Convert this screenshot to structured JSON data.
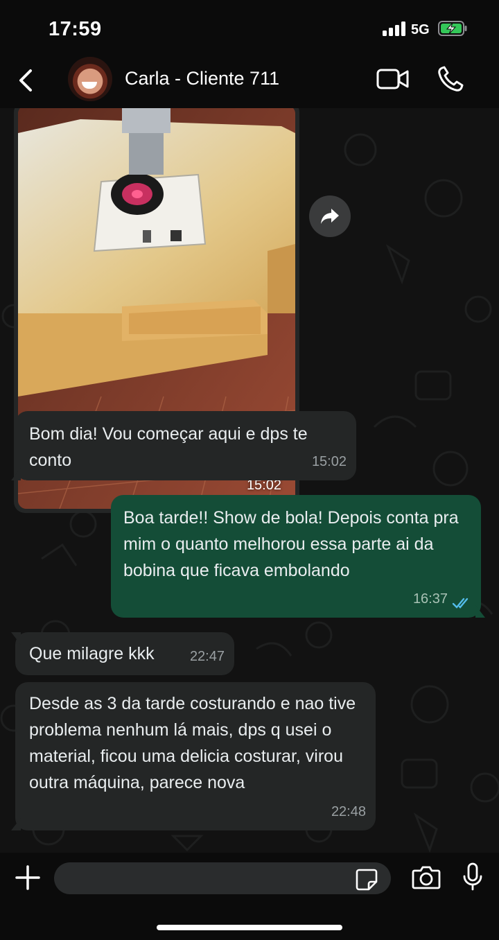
{
  "status_bar": {
    "time": "17:59",
    "network": "5G"
  },
  "header": {
    "contact_name": "Carla - Cliente 711"
  },
  "messages": [
    {
      "type": "image",
      "direction": "incoming",
      "time": "15:02"
    },
    {
      "type": "text",
      "direction": "incoming",
      "text": "Bom dia! Vou começar aqui e dps te conto",
      "time": "15:02"
    },
    {
      "type": "text",
      "direction": "outgoing",
      "text": "Boa tarde!! Show de bola! Depois conta pra mim o quanto melhorou essa parte ai da bobina que ficava embolando",
      "time": "16:37",
      "status": "read"
    },
    {
      "type": "text",
      "direction": "incoming",
      "text": "Que milagre kkk",
      "time": "22:47"
    },
    {
      "type": "text",
      "direction": "incoming",
      "text": "Desde as 3 da tarde costurando e nao tive problema nenhum lá mais, dps q usei o material, ficou uma delicia costurar, virou outra máquina, parece nova",
      "time": "22:48"
    }
  ],
  "composer": {
    "placeholder": ""
  },
  "colors": {
    "incoming_bubble": "#242626",
    "outgoing_bubble": "#144d37",
    "read_ticks": "#53bdeb",
    "background": "#121212"
  },
  "icons": [
    "back-chevron-icon",
    "video-call-icon",
    "phone-call-icon",
    "forward-icon",
    "plus-icon",
    "sticker-icon",
    "camera-icon",
    "microphone-icon",
    "read-ticks-icon"
  ]
}
